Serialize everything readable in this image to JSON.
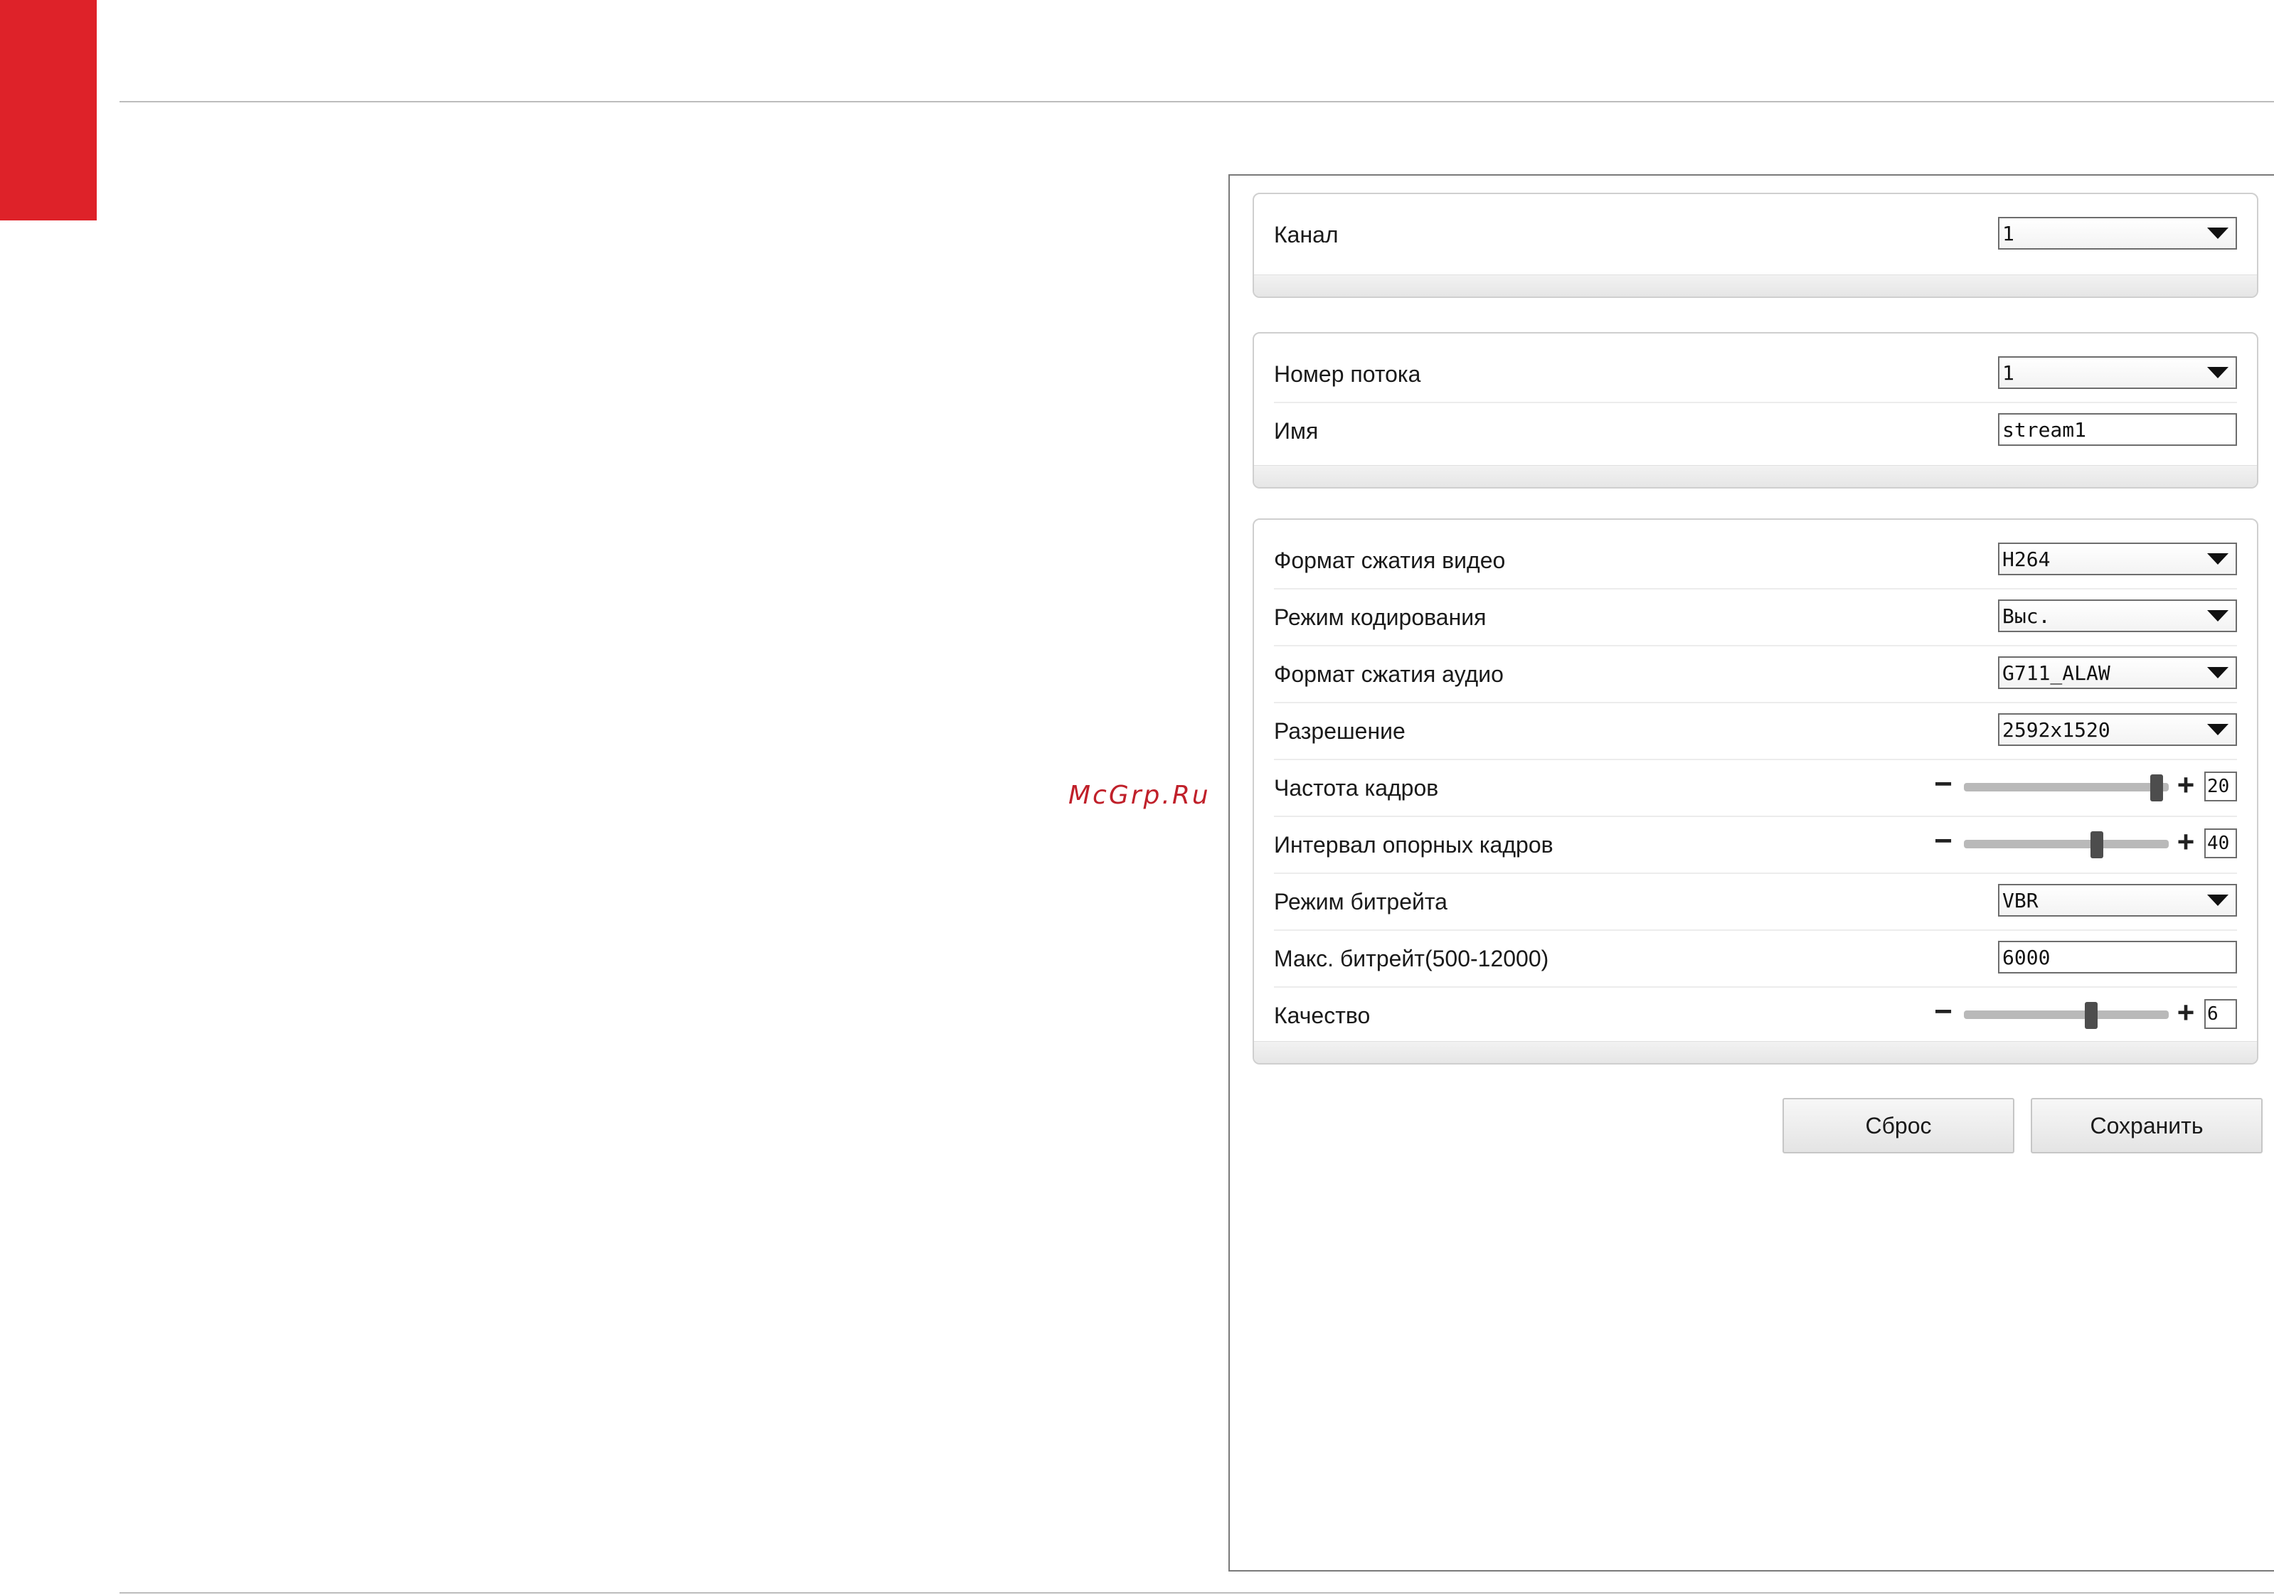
{
  "watermark": "McGrp.Ru",
  "panel_channel": {
    "rows": [
      {
        "label": "Канал",
        "value": "1"
      }
    ]
  },
  "panel_stream": {
    "rows": [
      {
        "label": "Номер потока",
        "value": "1"
      },
      {
        "label": "Имя",
        "value": "stream1"
      }
    ]
  },
  "panel_encoding": {
    "rows": [
      {
        "label": "Формат сжатия видео",
        "value": "H264"
      },
      {
        "label": "Режим кодирования",
        "value": "Выс."
      },
      {
        "label": "Формат сжатия аудио",
        "value": "G711_ALAW"
      },
      {
        "label": "Разрешение",
        "value": "2592x1520"
      },
      {
        "label": "Частота кадров",
        "value": "20",
        "slider_fraction": 0.94
      },
      {
        "label": "Интервал опорных кадров",
        "value": "40",
        "slider_fraction": 0.65
      },
      {
        "label": "Режим битрейта",
        "value": "VBR"
      },
      {
        "label": "Макс. битрейт(500-12000)",
        "value": "6000"
      },
      {
        "label": "Качество",
        "value": "6",
        "slider_fraction": 0.62
      }
    ]
  },
  "slider_symbols": {
    "minus": "−",
    "plus": "+"
  },
  "buttons": {
    "reset": "Сброс",
    "save": "Сохранить"
  },
  "colors": {
    "accent_red": "#de2229",
    "watermark": "#c0202a",
    "panel_border": "#cfcfcf"
  }
}
